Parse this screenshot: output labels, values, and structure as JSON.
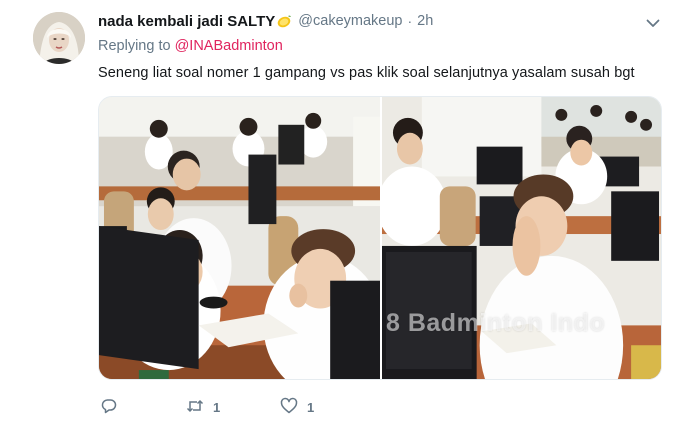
{
  "tweet": {
    "author": {
      "display_name": "nada kembali jadi SALTY",
      "handle": "@cakeymakeup",
      "time": "2h"
    },
    "separator": "·",
    "replying_to": {
      "prefix": "Replying to",
      "mention": "@INABadminton"
    },
    "text": "Seneng liat soal nomer 1 gampang vs pas klik soal selanjutnya yasalam susah bgt",
    "media": {
      "watermark": "8 Badminton Indo"
    },
    "actions": {
      "reply_count": "",
      "retweet_count": "1",
      "like_count": "1"
    }
  },
  "icons": {
    "emoji": "lemon-icon",
    "menu": "chevron-down-icon",
    "reply": "reply-icon",
    "retweet": "retweet-icon",
    "like": "heart-icon"
  },
  "colors": {
    "name": "#14171a",
    "secondary": "#657786",
    "mention": "#e0245e",
    "border": "#e6ecf0"
  }
}
